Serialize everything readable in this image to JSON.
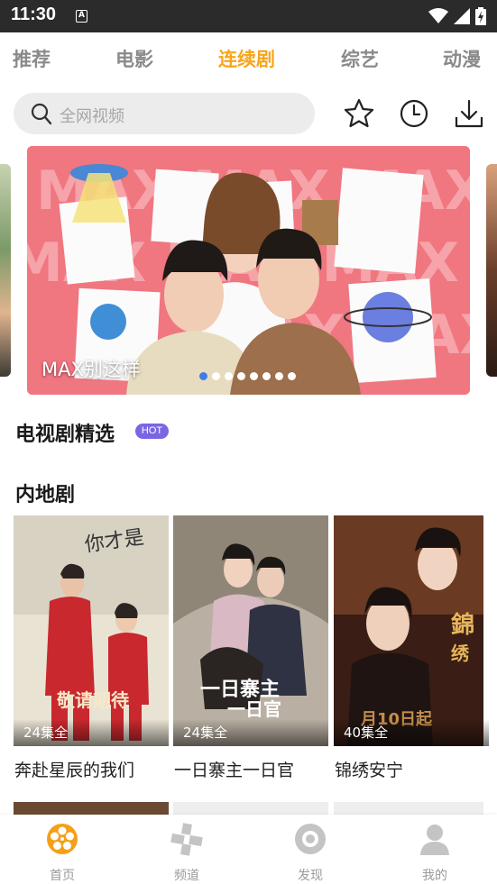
{
  "status": {
    "time": "11:30",
    "notification_letter": "A"
  },
  "tabs": [
    {
      "label": "推荐",
      "active": false
    },
    {
      "label": "电影",
      "active": false
    },
    {
      "label": "连续剧",
      "active": true
    },
    {
      "label": "综艺",
      "active": false
    },
    {
      "label": "动漫",
      "active": false
    }
  ],
  "search": {
    "placeholder": "全网视频"
  },
  "actions": {
    "favorite_icon": "star-icon",
    "history_icon": "clock-icon",
    "download_icon": "download-icon"
  },
  "banner": {
    "title": "MAX别这样",
    "slide_count": 8,
    "active_index": 0,
    "background_color": "#f0707a"
  },
  "sections": {
    "featured": {
      "title": "电视剧精选",
      "badge": "HOT"
    },
    "mainland": {
      "title": "内地剧"
    }
  },
  "posters": [
    {
      "episodes": "24集全",
      "name": "奔赴星辰的我们"
    },
    {
      "episodes": "24集全",
      "name": "一日寨主一日官"
    },
    {
      "episodes": "40集全",
      "name": "锦绣安宁"
    }
  ],
  "bottom_nav": [
    {
      "label": "首页",
      "icon": "film-reel-icon",
      "active": true
    },
    {
      "label": "频道",
      "icon": "channel-icon",
      "active": false
    },
    {
      "label": "发现",
      "icon": "discover-icon",
      "active": false
    },
    {
      "label": "我的",
      "icon": "user-icon",
      "active": false
    }
  ],
  "colors": {
    "accent": "#f9a51a",
    "hot_badge": "#7966e3",
    "dot_active": "#3d7ee6",
    "status_bar": "#2b2b2b"
  }
}
